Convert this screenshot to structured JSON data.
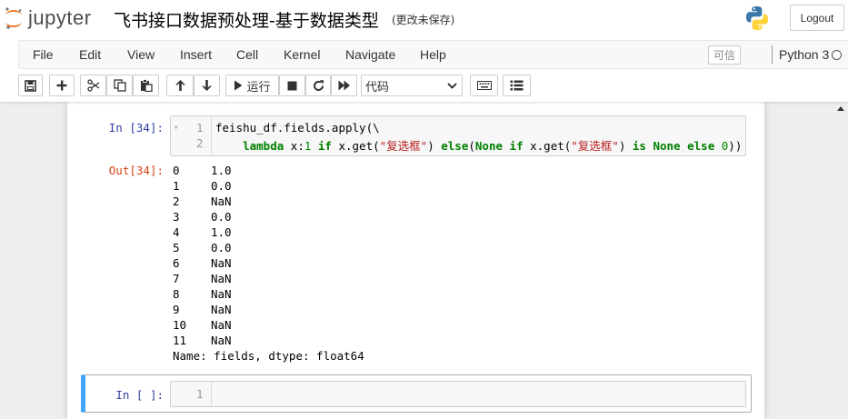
{
  "header": {
    "logo_text": "jupyter",
    "notebook_title": "飞书接口数据预处理-基于数据类型",
    "save_status": "(更改未保存)",
    "logout_label": "Logout"
  },
  "menubar": {
    "items": [
      "File",
      "Edit",
      "View",
      "Insert",
      "Cell",
      "Kernel",
      "Navigate",
      "Help"
    ],
    "trusted_label": "可信",
    "kernel_name": "Python 3"
  },
  "toolbar": {
    "run_label": "运行",
    "cell_type": "代码",
    "cell_type_options": [
      "代码"
    ]
  },
  "cells": [
    {
      "prompt": "In  [34]:",
      "line_numbers": [
        "1",
        "2"
      ],
      "out_prompt": "Out[34]:",
      "output_rows": [
        {
          "index": "0",
          "value": "1.0"
        },
        {
          "index": "1",
          "value": "0.0"
        },
        {
          "index": "2",
          "value": "NaN"
        },
        {
          "index": "3",
          "value": "0.0"
        },
        {
          "index": "4",
          "value": "1.0"
        },
        {
          "index": "5",
          "value": "0.0"
        },
        {
          "index": "6",
          "value": "NaN"
        },
        {
          "index": "7",
          "value": "NaN"
        },
        {
          "index": "8",
          "value": "NaN"
        },
        {
          "index": "9",
          "value": "NaN"
        },
        {
          "index": "10",
          "value": "NaN"
        },
        {
          "index": "11",
          "value": "NaN"
        }
      ],
      "output_footer": "Name: fields, dtype: float64"
    },
    {
      "prompt": "In  [ ]:",
      "line_numbers": [
        "1"
      ]
    }
  ],
  "code": {
    "l1_a": "feishu_df.fields.apply(\\",
    "l2_indent": "    ",
    "kw_lambda": "lambda",
    "l2_b": " x:",
    "n1": "1",
    "kw_if1": " if",
    "l2_c": " x.get(",
    "s1": "\"复选框\"",
    "l2_d": ")",
    "kw_else1": " else",
    "l2_e": "(",
    "kw_none1": "None",
    "kw_if2": " if",
    "l2_f": " x.get(",
    "s2": "\"复选框\"",
    "l2_g": ")",
    "kw_is": " is",
    "kw_none2": " None",
    "kw_else2": " else",
    "l2_h": " ",
    "n0": "0",
    "l2_i": "))"
  },
  "colors": {
    "in_prompt": "#303f9f",
    "out_prompt": "#d84315",
    "selected_cell_border": "#42a5f5",
    "keyword": "#008000",
    "string": "#ba2121"
  }
}
